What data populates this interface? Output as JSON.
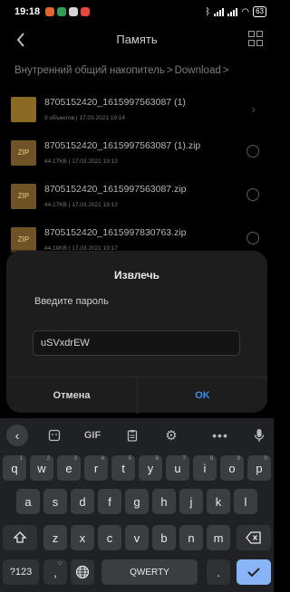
{
  "status": {
    "time": "19:18",
    "battery": "63"
  },
  "header": {
    "title": "Память"
  },
  "breadcrumb": {
    "root": "Внутренний общий накопитель",
    "folder": "Download",
    "sep": ">"
  },
  "files": [
    {
      "name": "8705152420_1615997563087 (1)",
      "size": "9 объектов",
      "date": "17.03.2021 19:14",
      "type": "folder"
    },
    {
      "name": "8705152420_1615997563087 (1).zip",
      "size": "44.17KB",
      "date": "17.03.2021 19:13",
      "type": "zip"
    },
    {
      "name": "8705152420_1615997563087.zip",
      "size": "44.17KB",
      "date": "17.03.2021 19:13",
      "type": "zip"
    },
    {
      "name": "8705152420_1615997830763.zip",
      "size": "44.18KB",
      "date": "17.03.2021 19:17",
      "type": "zip"
    }
  ],
  "zip_label": "ZIP",
  "meta_sep": "|",
  "dialog": {
    "title": "Извлечь",
    "prompt": "Введите пароль",
    "password": "uSVxdrEW",
    "cancel": "Отмена",
    "ok": "OK"
  },
  "keyboard": {
    "toolbar": {
      "gif": "GIF"
    },
    "row1": [
      "q",
      "w",
      "e",
      "r",
      "t",
      "y",
      "u",
      "i",
      "o",
      "p"
    ],
    "row1_hints": [
      "1",
      "2",
      "3",
      "4",
      "5",
      "6",
      "7",
      "8",
      "9",
      "0"
    ],
    "row2": [
      "a",
      "s",
      "d",
      "f",
      "g",
      "h",
      "j",
      "k",
      "l"
    ],
    "row3": [
      "z",
      "x",
      "c",
      "v",
      "b",
      "n",
      "m"
    ],
    "symbols": "?123",
    "comma": ",",
    "space": "QWERTY",
    "period": "."
  },
  "colors": {
    "accent": "#3b8cf0",
    "dialog_bg": "#1d1d1d",
    "keyboard_bg": "#202124"
  }
}
